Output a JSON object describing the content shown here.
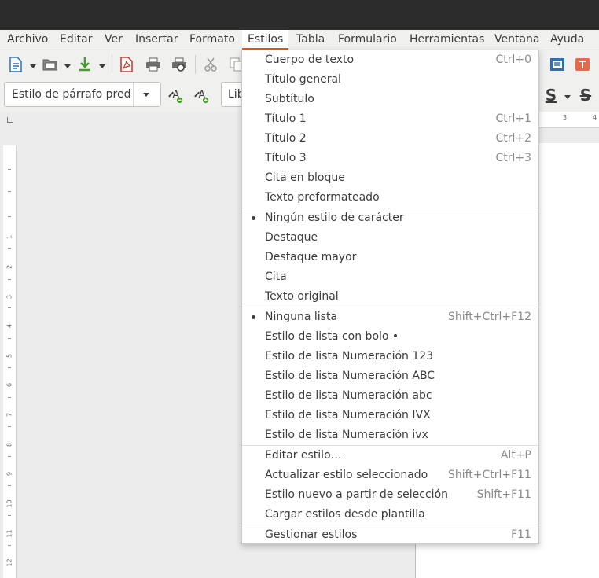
{
  "menubar": {
    "items": [
      "Archivo",
      "Editar",
      "Ver",
      "Insertar",
      "Formato",
      "Estilos",
      "Tabla",
      "Formulario",
      "Herramientas",
      "Ventana",
      "Ayuda"
    ],
    "active": "Estilos"
  },
  "toolbar": {
    "paragraph_style": "Estilo de párrafo pred",
    "font_name": "Lib",
    "icons": [
      "new-document-icon",
      "open-folder-icon",
      "save-icon",
      "export-pdf-icon",
      "print-icon",
      "print-preview-icon",
      "cut-icon",
      "copy-icon",
      "update-style-icon",
      "new-style-icon",
      "underline-s-icon",
      "strikethrough-icon",
      "insert-frame-icon",
      "textbox-icon"
    ]
  },
  "ruler": {
    "vertical_numbers": [
      "1",
      "2",
      "3",
      "4",
      "5",
      "6",
      "7",
      "8",
      "9",
      "10",
      "11",
      "12"
    ],
    "horizontal_numbers": [
      "3",
      "4"
    ]
  },
  "styles_menu": {
    "groups": [
      [
        {
          "label": "Cuerpo de texto",
          "shortcut": "Ctrl+0"
        },
        {
          "label": "Título general",
          "shortcut": ""
        },
        {
          "label": "Subtítulo",
          "shortcut": ""
        },
        {
          "label": "Título 1",
          "shortcut": "Ctrl+1"
        },
        {
          "label": "Título 2",
          "shortcut": "Ctrl+2"
        },
        {
          "label": "Título 3",
          "shortcut": "Ctrl+3"
        },
        {
          "label": "Cita en bloque",
          "shortcut": ""
        },
        {
          "label": "Texto preformateado",
          "shortcut": ""
        }
      ],
      [
        {
          "label": "Ningún estilo de carácter",
          "shortcut": "",
          "checked": true
        },
        {
          "label": "Destaque",
          "shortcut": ""
        },
        {
          "label": "Destaque mayor",
          "shortcut": ""
        },
        {
          "label": "Cita",
          "shortcut": ""
        },
        {
          "label": "Texto original",
          "shortcut": ""
        }
      ],
      [
        {
          "label": "Ninguna lista",
          "shortcut": "Shift+Ctrl+F12",
          "checked": true
        },
        {
          "label": "Estilo de lista con bolo •",
          "shortcut": ""
        },
        {
          "label": "Estilo de lista Numeración 123",
          "shortcut": ""
        },
        {
          "label": "Estilo de lista Numeración ABC",
          "shortcut": ""
        },
        {
          "label": "Estilo de lista Numeración abc",
          "shortcut": ""
        },
        {
          "label": "Estilo de lista Numeración IVX",
          "shortcut": ""
        },
        {
          "label": "Estilo de lista Numeración ivx",
          "shortcut": ""
        }
      ],
      [
        {
          "label": "Editar estilo…",
          "shortcut": "Alt+P"
        },
        {
          "label": "Actualizar estilo seleccionado",
          "shortcut": "Shift+Ctrl+F11"
        },
        {
          "label": "Estilo nuevo a partir de selección",
          "shortcut": "Shift+F11"
        },
        {
          "label": "Cargar estilos desde plantilla",
          "shortcut": ""
        }
      ],
      [
        {
          "label": "Gestionar estilos",
          "shortcut": "F11"
        }
      ]
    ]
  },
  "colors": {
    "accent": "#e95420",
    "menubar_bg": "#f0f0ef",
    "titlebar_bg": "#2c2c2c"
  }
}
